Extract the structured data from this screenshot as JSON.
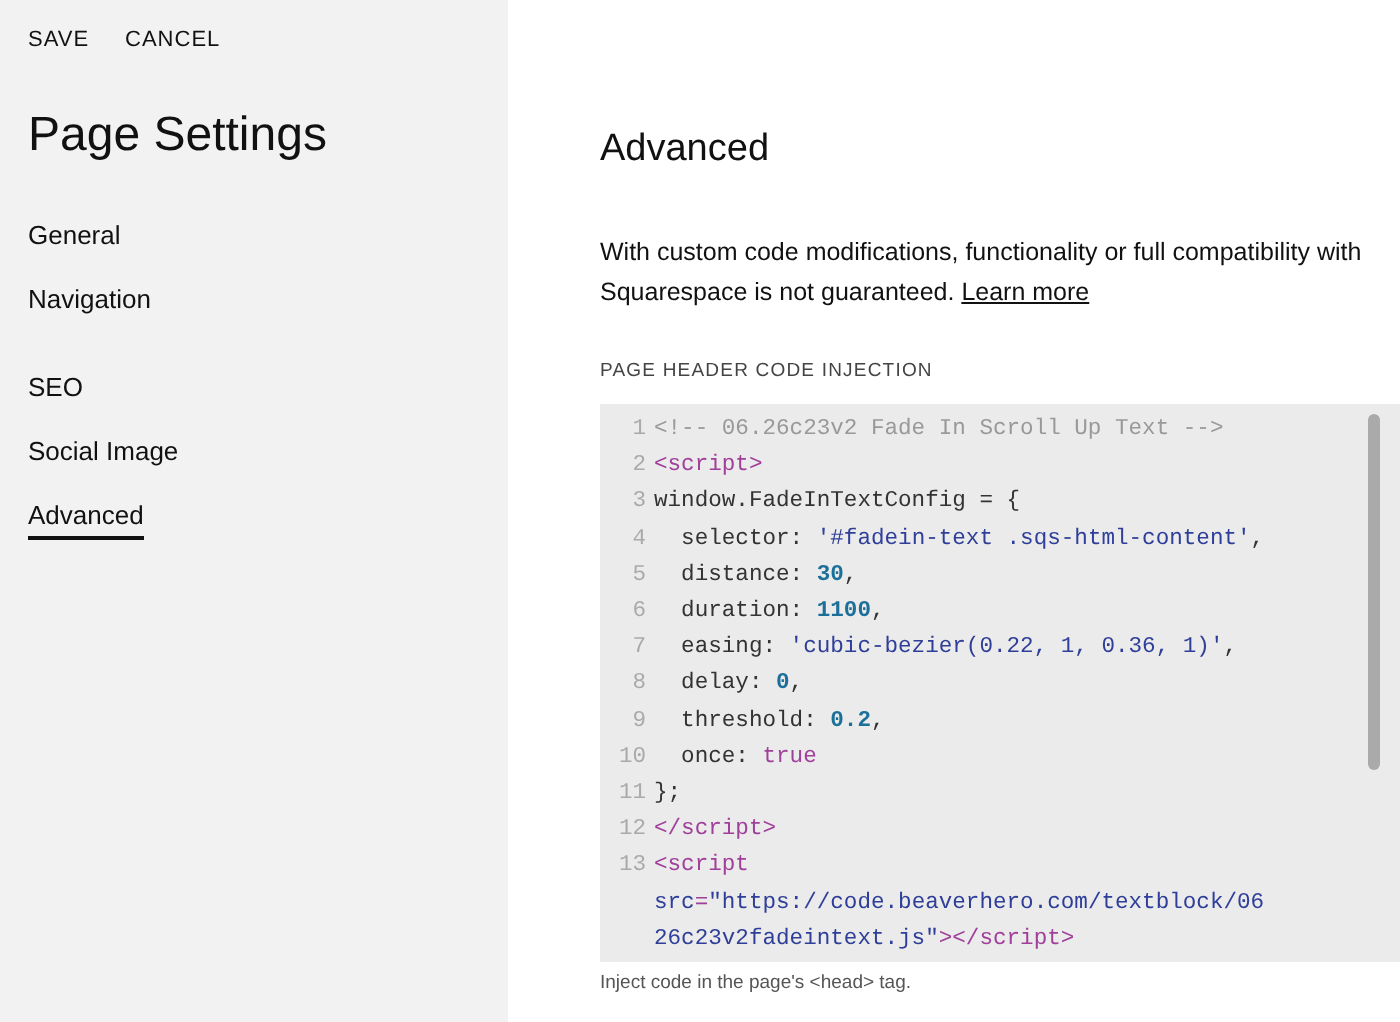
{
  "header_actions": [
    "SAVE",
    "CANCEL"
  ],
  "sidebar": {
    "title": "Page Settings",
    "groups": [
      {
        "items": [
          {
            "label": "General",
            "selected": false
          },
          {
            "label": "Navigation",
            "selected": false
          }
        ]
      },
      {
        "items": [
          {
            "label": "SEO",
            "selected": false
          },
          {
            "label": "Social Image",
            "selected": false
          },
          {
            "label": "Advanced",
            "selected": true
          }
        ]
      }
    ]
  },
  "panel": {
    "title": "Advanced",
    "description": "With custom code modifications, functionality or full compatibility with Squarespace is not guaranteed.",
    "link": "Learn more",
    "code_injection": {
      "label": "PAGE HEADER CODE INJECTION",
      "help": "Inject code in the page's <head> tag.",
      "lines": [
        {
          "number": "1",
          "tokens": [
            {
              "kind": "comment",
              "text": "<!-- 06.26c23v2 Fade In Scroll Up Text -->"
            }
          ]
        },
        {
          "number": "2",
          "tokens": [
            {
              "kind": "tag",
              "text": "<script>"
            }
          ]
        },
        {
          "number": "3",
          "tokens": [
            {
              "kind": "plain",
              "text": "window.FadeInTextConfig = {"
            }
          ]
        },
        {
          "number": "4",
          "tokens": [
            {
              "kind": "plain",
              "text": "  selector: "
            },
            {
              "kind": "string",
              "text": "'#fadein-text .sqs-html-content'"
            },
            {
              "kind": "plain",
              "text": ","
            }
          ]
        },
        {
          "number": "5",
          "tokens": [
            {
              "kind": "plain",
              "text": "  distance: "
            },
            {
              "kind": "number",
              "text": "30"
            },
            {
              "kind": "plain",
              "text": ","
            }
          ]
        },
        {
          "number": "6",
          "tokens": [
            {
              "kind": "plain",
              "text": "  duration: "
            },
            {
              "kind": "number",
              "text": "1100"
            },
            {
              "kind": "plain",
              "text": ","
            }
          ]
        },
        {
          "number": "7",
          "tokens": [
            {
              "kind": "plain",
              "text": "  easing: "
            },
            {
              "kind": "string",
              "text": "'cubic-bezier(0.22, 1, 0.36, 1)'"
            },
            {
              "kind": "plain",
              "text": ","
            }
          ]
        },
        {
          "number": "8",
          "tokens": [
            {
              "kind": "plain",
              "text": "  delay: "
            },
            {
              "kind": "number",
              "text": "0"
            },
            {
              "kind": "plain",
              "text": ","
            }
          ]
        },
        {
          "number": "9",
          "tokens": [
            {
              "kind": "plain",
              "text": "  threshold: "
            },
            {
              "kind": "number",
              "text": "0.2"
            },
            {
              "kind": "plain",
              "text": ","
            }
          ]
        },
        {
          "number": "10",
          "tokens": [
            {
              "kind": "plain",
              "text": "  once: "
            },
            {
              "kind": "keyword",
              "text": "true"
            }
          ]
        },
        {
          "number": "11",
          "tokens": [
            {
              "kind": "plain",
              "text": "};"
            }
          ]
        },
        {
          "number": "12",
          "tokens": [
            {
              "kind": "tag",
              "text": "</script>"
            }
          ]
        },
        {
          "number": "13",
          "tokens": [
            {
              "kind": "tag",
              "text": "<script"
            }
          ]
        },
        {
          "tokens": [
            {
              "kind": "attr",
              "text": "src"
            },
            {
              "kind": "tag",
              "text": "="
            },
            {
              "kind": "string",
              "text": "\"https://code.beaverhero.com/textblock/06"
            }
          ]
        },
        {
          "tokens": [
            {
              "kind": "string",
              "text": "26c23v2fadeintext.js\""
            },
            {
              "kind": "tag",
              "text": "></script>"
            }
          ]
        }
      ]
    }
  }
}
